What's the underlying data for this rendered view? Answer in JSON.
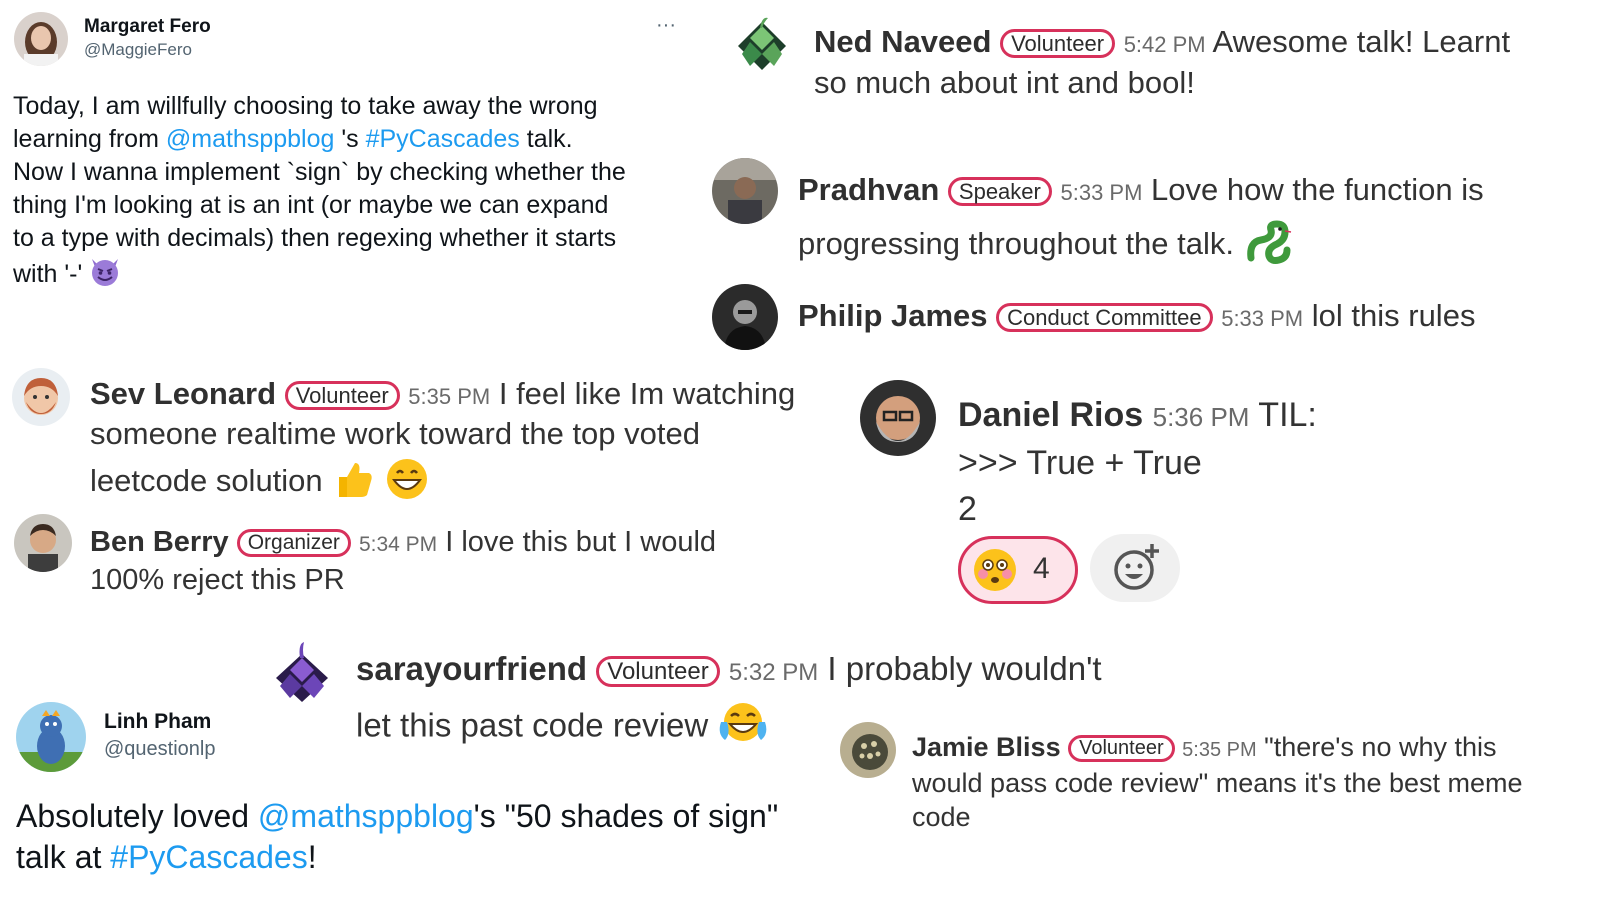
{
  "colors": {
    "accent": "#d7315b",
    "link": "#1d9bf0",
    "reaction_bg": "#fde4ea"
  },
  "tweet1": {
    "name": "Margaret Fero",
    "handle": "@MaggieFero",
    "menu": "···",
    "p1": "Today, I am willfully choosing to take away the wrong learning from ",
    "mention": "@mathsppblog",
    "p2": " 's ",
    "hashtag": "#PyCascades",
    "p3": " talk.",
    "line3": "Now I wanna implement `sign` by checking whether the",
    "line4": "thing I'm looking at is an int (or maybe we can expand",
    "line5": "to a type with decimals) then regexing whether it starts",
    "line6": "with '-' ",
    "emoji": "smiling-devil"
  },
  "ned": {
    "name": "Ned Naveed",
    "role": "Volunteer",
    "time": "5:42 PM",
    "text1": "Awesome talk! Learnt",
    "text2": "so much about int and bool!"
  },
  "pradhvan": {
    "name": "Pradhvan",
    "role": "Speaker",
    "time": "5:33 PM",
    "text1": "Love how the function is",
    "text2": "progressing throughout the talk.",
    "emoji": "snake"
  },
  "philip": {
    "name": "Philip James",
    "role": "Conduct Committee",
    "time": "5:33 PM",
    "text1": "lol this rules"
  },
  "sev": {
    "name": "Sev Leonard",
    "role": "Volunteer",
    "time": "5:35 PM",
    "text1": "I feel like Im watching",
    "text2": "someone realtime work toward the top voted",
    "text3": "leetcode solution",
    "emojis": [
      "thumbs-up",
      "grinning-face"
    ]
  },
  "daniel": {
    "name": "Daniel Rios",
    "time": "5:36 PM",
    "text1": "TIL:",
    "text2": ">>> True + True",
    "text3": "2",
    "reaction_emoji": "flushed-face",
    "reaction_count": "4",
    "add_reaction_icon": "add-reaction-icon"
  },
  "ben": {
    "name": "Ben Berry",
    "role": "Organizer",
    "time": "5:34 PM",
    "text1": "I love this but I would",
    "text2": "100% reject this PR"
  },
  "sara": {
    "name": "sarayourfriend",
    "role": "Volunteer",
    "time": "5:32 PM",
    "text1": "I probably wouldn't",
    "text2": "let this past code review",
    "emoji": "tears-of-joy"
  },
  "jamie": {
    "name": "Jamie Bliss",
    "role": "Volunteer",
    "time": "5:35 PM",
    "text1": "\"there's no why this",
    "text2": "would pass code review\" means it's the best meme",
    "text3": "code"
  },
  "tweet2": {
    "name": "Linh Pham",
    "handle": "@questionlp",
    "p1": "Absolutely loved ",
    "mention": "@mathsppblog",
    "p2": "'s \"50 shades of sign\"",
    "p3": "talk at ",
    "hashtag": "#PyCascades",
    "p4": "!"
  }
}
